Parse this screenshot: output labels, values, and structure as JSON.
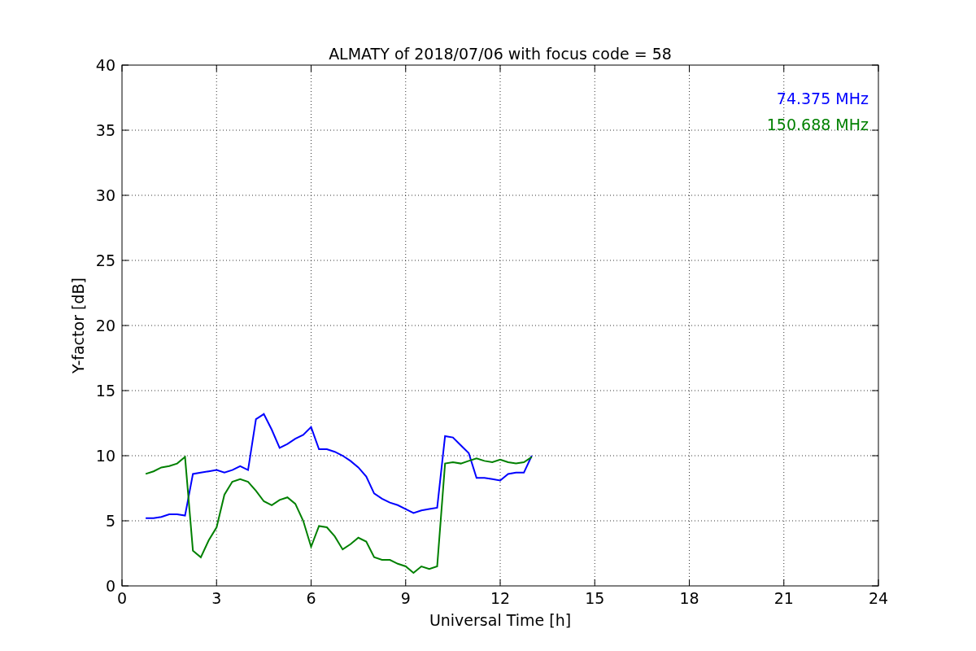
{
  "figure": {
    "chart_data": {
      "type": "line",
      "title": "ALMATY of 2018/07/06 with focus code = 58",
      "xlabel": "Universal Time [h]",
      "ylabel": "Y-factor [dB]",
      "xlim": [
        0,
        24
      ],
      "ylim": [
        0,
        40
      ],
      "xticks": [
        0,
        3,
        6,
        9,
        12,
        15,
        18,
        21,
        24
      ],
      "yticks": [
        0,
        5,
        10,
        15,
        20,
        25,
        30,
        35,
        40
      ],
      "grid": true,
      "x": [
        0.75,
        1.0,
        1.25,
        1.5,
        1.75,
        2.0,
        2.25,
        2.5,
        2.75,
        3.0,
        3.25,
        3.5,
        3.75,
        4.0,
        4.25,
        4.5,
        4.75,
        5.0,
        5.25,
        5.5,
        5.75,
        6.0,
        6.25,
        6.5,
        6.75,
        7.0,
        7.25,
        7.5,
        7.75,
        8.0,
        8.25,
        8.5,
        8.75,
        9.0,
        9.25,
        9.5,
        9.75,
        10.0,
        10.25,
        10.5,
        10.75,
        11.0,
        11.25,
        11.5,
        11.75,
        12.0,
        12.25,
        12.5,
        12.75,
        13.0
      ],
      "series": [
        {
          "name": "74.375 MHz",
          "color": "#0000ff",
          "values": [
            5.2,
            5.2,
            5.3,
            5.5,
            5.5,
            5.4,
            8.6,
            8.7,
            8.8,
            8.9,
            8.7,
            8.9,
            9.2,
            8.9,
            12.8,
            13.2,
            12.0,
            10.6,
            10.9,
            11.3,
            11.6,
            12.2,
            10.5,
            10.5,
            10.3,
            10.0,
            9.6,
            9.1,
            8.4,
            7.1,
            6.7,
            6.4,
            6.2,
            5.9,
            5.6,
            5.8,
            5.9,
            6.0,
            11.5,
            11.4,
            10.8,
            10.2,
            8.3,
            8.3,
            8.2,
            8.1,
            8.6,
            8.7,
            8.7,
            10.0
          ]
        },
        {
          "name": "150.688 MHz",
          "color": "#008000",
          "values": [
            8.6,
            8.8,
            9.1,
            9.2,
            9.4,
            9.9,
            2.7,
            2.2,
            3.5,
            4.5,
            7.0,
            8.0,
            8.2,
            8.0,
            7.3,
            6.5,
            6.2,
            6.6,
            6.8,
            6.3,
            5.0,
            3.0,
            4.6,
            4.5,
            3.8,
            2.8,
            3.2,
            3.7,
            3.4,
            2.2,
            2.0,
            2.0,
            1.7,
            1.5,
            1.0,
            1.5,
            1.3,
            1.5,
            9.4,
            9.5,
            9.4,
            9.6,
            9.8,
            9.6,
            9.5,
            9.7,
            9.5,
            9.4,
            9.5,
            9.9
          ]
        }
      ]
    }
  }
}
